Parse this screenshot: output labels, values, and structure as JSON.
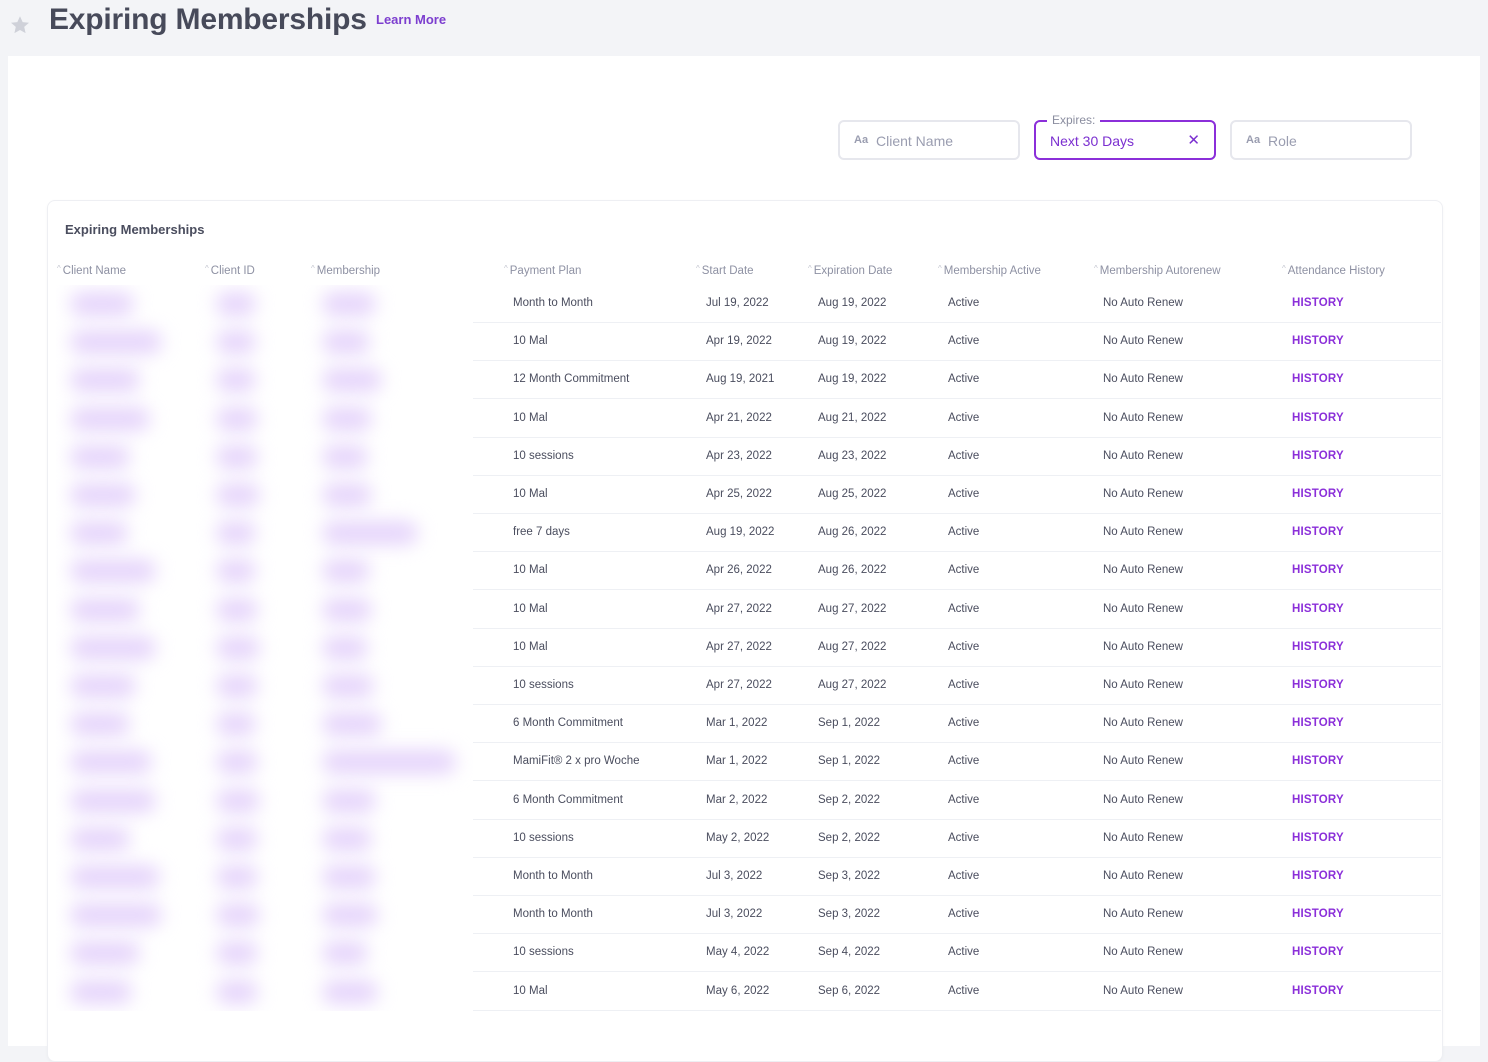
{
  "header": {
    "title": "Expiring Memberships",
    "learn_more": "Learn More"
  },
  "filters": {
    "client_name": {
      "icon": "Aa",
      "placeholder": "Client Name"
    },
    "expires": {
      "legend": "Expires:",
      "value": "Next 30 Days",
      "clear": "✕"
    },
    "role": {
      "icon": "Aa",
      "placeholder": "Role"
    }
  },
  "table": {
    "title": "Expiring Memberships",
    "columns": [
      "Client Name",
      "Client ID",
      "Membership",
      "Payment Plan",
      "Start Date",
      "Expiration Date",
      "Membership Active",
      "Membership Autorenew",
      "Attendance History"
    ],
    "history_label": "HISTORY",
    "rows": [
      {
        "plan": "Month to Month",
        "start": "Jul 19, 2022",
        "exp": "Aug 19, 2022",
        "active": "Active",
        "autorenew": "No Auto Renew"
      },
      {
        "plan": "10 Mal",
        "start": "Apr 19, 2022",
        "exp": "Aug 19, 2022",
        "active": "Active",
        "autorenew": "No Auto Renew"
      },
      {
        "plan": "12 Month Commitment",
        "start": "Aug 19, 2021",
        "exp": "Aug 19, 2022",
        "active": "Active",
        "autorenew": "No Auto Renew"
      },
      {
        "plan": "10 Mal",
        "start": "Apr 21, 2022",
        "exp": "Aug 21, 2022",
        "active": "Active",
        "autorenew": "No Auto Renew"
      },
      {
        "plan": "10 sessions",
        "start": "Apr 23, 2022",
        "exp": "Aug 23, 2022",
        "active": "Active",
        "autorenew": "No Auto Renew"
      },
      {
        "plan": "10 Mal",
        "start": "Apr 25, 2022",
        "exp": "Aug 25, 2022",
        "active": "Active",
        "autorenew": "No Auto Renew"
      },
      {
        "plan": "free 7 days",
        "start": "Aug 19, 2022",
        "exp": "Aug 26, 2022",
        "active": "Active",
        "autorenew": "No Auto Renew"
      },
      {
        "plan": "10 Mal",
        "start": "Apr 26, 2022",
        "exp": "Aug 26, 2022",
        "active": "Active",
        "autorenew": "No Auto Renew"
      },
      {
        "plan": "10 Mal",
        "start": "Apr 27, 2022",
        "exp": "Aug 27, 2022",
        "active": "Active",
        "autorenew": "No Auto Renew"
      },
      {
        "plan": "10 Mal",
        "start": "Apr 27, 2022",
        "exp": "Aug 27, 2022",
        "active": "Active",
        "autorenew": "No Auto Renew"
      },
      {
        "plan": "10 sessions",
        "start": "Apr 27, 2022",
        "exp": "Aug 27, 2022",
        "active": "Active",
        "autorenew": "No Auto Renew"
      },
      {
        "plan": "6 Month Commitment",
        "start": "Mar 1, 2022",
        "exp": "Sep 1, 2022",
        "active": "Active",
        "autorenew": "No Auto Renew"
      },
      {
        "plan": "MamiFit® 2 x pro Woche",
        "start": "Mar 1, 2022",
        "exp": "Sep 1, 2022",
        "active": "Active",
        "autorenew": "No Auto Renew"
      },
      {
        "plan": "6 Month Commitment",
        "start": "Mar 2, 2022",
        "exp": "Sep 2, 2022",
        "active": "Active",
        "autorenew": "No Auto Renew"
      },
      {
        "plan": "10 sessions",
        "start": "May 2, 2022",
        "exp": "Sep 2, 2022",
        "active": "Active",
        "autorenew": "No Auto Renew"
      },
      {
        "plan": "Month to Month",
        "start": "Jul 3, 2022",
        "exp": "Sep 3, 2022",
        "active": "Active",
        "autorenew": "No Auto Renew"
      },
      {
        "plan": "Month to Month",
        "start": "Jul 3, 2022",
        "exp": "Sep 3, 2022",
        "active": "Active",
        "autorenew": "No Auto Renew"
      },
      {
        "plan": "10 sessions",
        "start": "May 4, 2022",
        "exp": "Sep 4, 2022",
        "active": "Active",
        "autorenew": "No Auto Renew"
      },
      {
        "plan": "10 Mal",
        "start": "May 6, 2022",
        "exp": "Sep 6, 2022",
        "active": "Active",
        "autorenew": "No Auto Renew"
      }
    ]
  },
  "colors": {
    "accent": "#8b2fd9",
    "background": "#f3f4f7",
    "blurred_cells": "#e6d5fb"
  },
  "icons": [
    "star-icon",
    "text-filter-icon",
    "clear-icon",
    "sort-icon"
  ]
}
